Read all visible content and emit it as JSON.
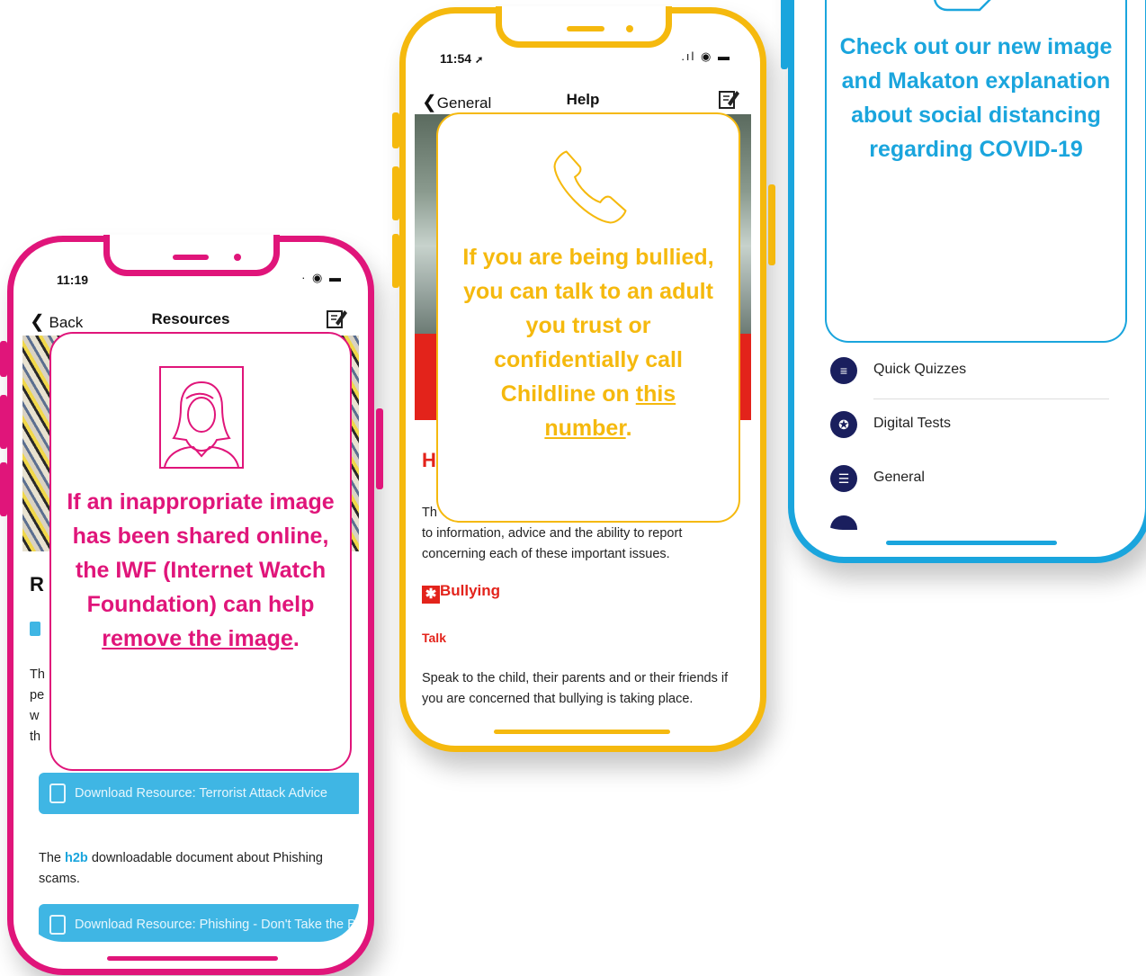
{
  "colors": {
    "pink": "#e0157a",
    "yellow": "#f5b90e",
    "blue": "#1aa5dd",
    "alert_red": "#e3231b",
    "navy": "#1a1f5e"
  },
  "phone_resources": {
    "status_time": "11:19",
    "nav": {
      "back": "Back",
      "title": "Resources",
      "edit_icon": "edit-icon"
    },
    "overlay": {
      "icon": "person-portrait-icon",
      "text": "If an inappropriate image has been shared online, the IWF (Internet Watch Foundation) can help ",
      "link": "remove the image",
      "tail": "."
    },
    "partial_heading": "R",
    "partial_lines": [
      "Th",
      "pe",
      "w",
      "th"
    ],
    "download_1": "Download Resource: Terrorist Attack Advice",
    "paragraph_pre": "The ",
    "brand": "h2b",
    "paragraph_post": " downloadable document about Phishing scams.",
    "download_2": "Download Resource: Phishing - Don't Take the Bait!"
  },
  "phone_help": {
    "status_time": "11:54",
    "nav": {
      "back": "General",
      "title": "Help",
      "edit_icon": "edit-icon"
    },
    "overlay": {
      "icon": "phone-icon",
      "text": "If you are being bullied, you can talk to an adult you trust or confidentially call Childline on ",
      "link": "this number",
      "tail": "."
    },
    "partial_heading": "H",
    "partial_line": "Th",
    "intro_lines": "to information, advice and the ability to report concerning each of these important issues.",
    "section_title": "Bullying",
    "subsection": "Talk",
    "paragraph": "Speak to the child, their parents and or their friends if you are concerned that bullying is taking place."
  },
  "phone_menu": {
    "overlay": {
      "icon": "edit-icon",
      "text": "Check out our new image and Makaton explanation about social distancing regarding COVID-19"
    },
    "menu_items": [
      {
        "label": "Quick Quizzes",
        "icon": "clipboard-icon"
      },
      {
        "label": "Digital Tests",
        "icon": "badge-icon"
      },
      {
        "label": "General",
        "icon": "stack-icon"
      }
    ]
  }
}
